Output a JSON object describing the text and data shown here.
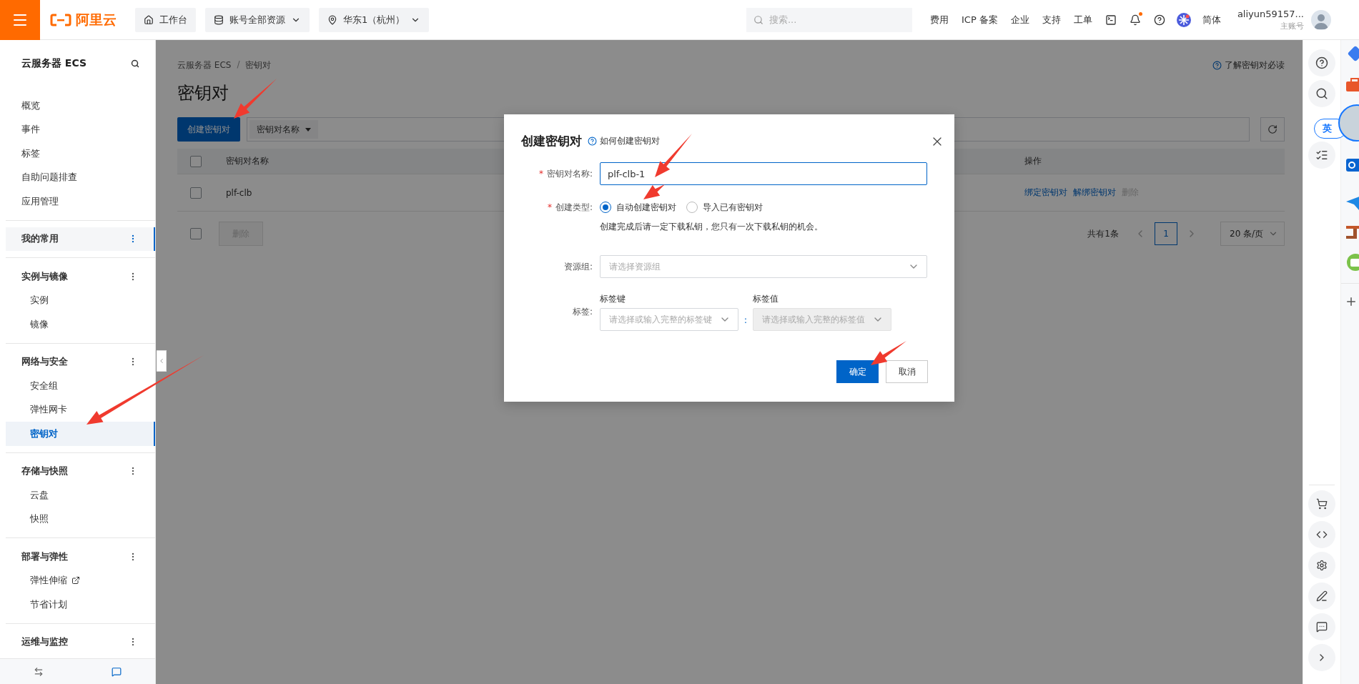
{
  "topbar": {
    "logo": "阿里云",
    "nav": [
      {
        "label": "工作台",
        "dropdown": false
      },
      {
        "label": "账号全部资源",
        "dropdown": true
      },
      {
        "label": "华东1（杭州）",
        "dropdown": true
      }
    ],
    "search": {
      "placeholder": "搜索..."
    },
    "links": [
      "费用",
      "ICP 备案",
      "企业",
      "支持",
      "工单"
    ],
    "unread": true,
    "language": "简体",
    "account": {
      "name": "aliyun59157...",
      "role": "主账号"
    }
  },
  "sidebar": {
    "title": "云服务器 ECS",
    "items": [
      {
        "label": "概览",
        "selected": false
      },
      {
        "label": "事件",
        "selected": false
      },
      {
        "label": "标签",
        "selected": false
      },
      {
        "label": "自助问题排查",
        "selected": false
      },
      {
        "label": "应用管理",
        "selected": false
      }
    ],
    "groups": [
      {
        "label": "我的常用",
        "selected": true
      },
      {
        "label": "实例与镜像",
        "selected": false,
        "children": [
          {
            "label": "实例",
            "selected": false
          },
          {
            "label": "镜像",
            "selected": false
          }
        ]
      },
      {
        "label": "网络与安全",
        "selected": false,
        "children": [
          {
            "label": "安全组",
            "selected": false
          },
          {
            "label": "弹性网卡",
            "selected": false
          },
          {
            "label": "密钥对",
            "selected": true
          }
        ]
      },
      {
        "label": "存储与快照",
        "selected": false,
        "children": [
          {
            "label": "云盘",
            "selected": false
          },
          {
            "label": "快照",
            "selected": false
          }
        ]
      },
      {
        "label": "部署与弹性",
        "selected": false,
        "children": [
          {
            "label": "弹性伸缩",
            "selected": false,
            "external": true
          },
          {
            "label": "节省计划",
            "selected": false,
            "external": false
          }
        ]
      },
      {
        "label": "运维与监控",
        "selected": false
      }
    ]
  },
  "main": {
    "breadcrumb": [
      "云服务器 ECS",
      "密钥对"
    ],
    "breadcrumb_separator": "/",
    "help_link": "了解密钥对必读",
    "title": "密钥对",
    "create_button": "创建密钥对",
    "filter": {
      "field": "密钥对名称"
    },
    "table": {
      "header_checked": false,
      "columns": [
        "密钥对名称",
        "操作"
      ],
      "rows": [
        {
          "checked": false,
          "name": "plf-clb",
          "actions": [
            {
              "label": "绑定密钥对",
              "disabled": false
            },
            {
              "label": "解绑密钥对",
              "disabled": false
            },
            {
              "label": "删除",
              "disabled": true
            }
          ]
        }
      ]
    },
    "footer": {
      "checked": false,
      "delete_button": {
        "label": "删除",
        "disabled": true
      },
      "total": "共有1条",
      "pages": [
        {
          "label": "1",
          "selected": true
        }
      ],
      "page_size": "20 条/页"
    }
  },
  "modal": {
    "title": "创建密钥对",
    "help_link": "如何创建密钥对",
    "fields": [
      {
        "kind": "text",
        "label": "密钥对名称:",
        "required_mark": "*",
        "value": "plf-clb-1"
      },
      {
        "kind": "radio",
        "label": "创建类型:",
        "required_mark": "*",
        "options": [
          {
            "label": "自动创建密钥对",
            "selected": true
          },
          {
            "label": "导入已有密钥对",
            "selected": false
          }
        ],
        "hint": "创建完成后请一定下载私钥，您只有一次下载私钥的机会。"
      },
      {
        "kind": "select",
        "label": "资源组:",
        "placeholder": "请选择资源组"
      },
      {
        "kind": "tags",
        "label": "标签:",
        "key_label": "标签键",
        "key_placeholder": "请选择或输入完整的标签键",
        "separator": ":",
        "value_label": "标签值",
        "value_placeholder": "请选择或输入完整的标签值",
        "value_disabled": true
      }
    ],
    "buttons": [
      {
        "label": "确定",
        "kind": "primary"
      },
      {
        "label": "取消",
        "kind": "default"
      }
    ]
  },
  "right_rail": {
    "language_indicator": "英"
  }
}
